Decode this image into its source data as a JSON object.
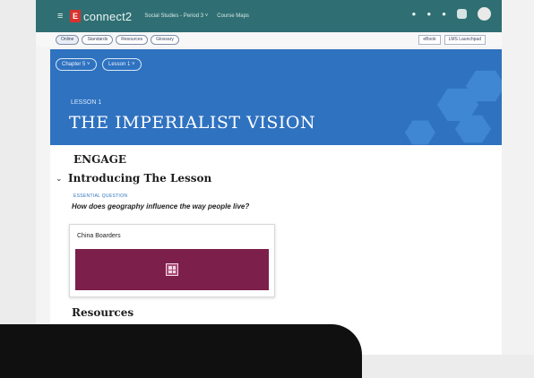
{
  "topbar": {
    "brand_logo": "E",
    "brand_name": "connect2",
    "course_crumb": "Social Studies - Period 3  ˅",
    "course_map": "Course Maps",
    "menu_icon": "hamburger-icon"
  },
  "subnav": {
    "pills": [
      "Online",
      "Standards",
      "Resources",
      "Glossary"
    ],
    "right_buttons": [
      "eBook",
      "LMS Launchpad"
    ]
  },
  "hero": {
    "chips": [
      "Chapter 5  ˅",
      "Lesson 1  ˅"
    ],
    "lesson_number": "LESSON 1",
    "lesson_title": "THE IMPERIALIST VISION",
    "background": "#2f72c0"
  },
  "content": {
    "engage": "ENGAGE",
    "intro_title": "Introducing The Lesson",
    "eq_label": "ESSENTIAL QUESTION",
    "eq_text": "How does geography influence the way people live?",
    "card_title": "China Boarders",
    "card_media_color": "#7c1f4b",
    "resources": "Resources"
  }
}
